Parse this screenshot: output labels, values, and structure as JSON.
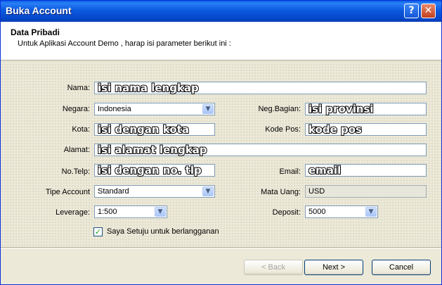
{
  "window": {
    "title": "Buka Account",
    "help_glyph": "?",
    "close_glyph": "✕"
  },
  "header": {
    "title": "Data Pribadi",
    "subtitle": "Untuk Aplikasi Account Demo , harap isi parameter berikut ini :"
  },
  "form": {
    "nama": {
      "label": "Nama:",
      "value": "isi nama lengkap"
    },
    "negara": {
      "label": "Negara:",
      "value": "Indonesia"
    },
    "neg_bagian": {
      "label": "Neg.Bagian:",
      "value": "isi provinsi"
    },
    "kota": {
      "label": "Kota:",
      "value": "isi dengan kota"
    },
    "kode_pos": {
      "label": "Kode Pos:",
      "value": "kode pos"
    },
    "alamat": {
      "label": "Alamat:",
      "value": "isi alamat lengkap"
    },
    "no_telp": {
      "label": "No.Telp:",
      "value": "isi dengan no. tlp"
    },
    "email": {
      "label": "Email:",
      "value": "email"
    },
    "tipe_account": {
      "label": "Tipe Account",
      "value": "Standard"
    },
    "mata_uang": {
      "label": "Mata Uang:",
      "value": "USD"
    },
    "leverage": {
      "label": "Leverage:",
      "value": "1:500"
    },
    "deposit": {
      "label": "Deposit:",
      "value": "5000"
    },
    "subscribe": {
      "label": "Saya Setuju untuk berlangganan",
      "checked": true
    }
  },
  "buttons": {
    "back": "< Back",
    "next": "Next >",
    "cancel": "Cancel"
  },
  "icons": {
    "dropdown": "chevron-down-icon",
    "check": "checkmark-icon"
  },
  "colors": {
    "titlebar": "#0a5fe8",
    "field_border": "#7f9db9",
    "dialog_bg": "#ece9d8"
  }
}
